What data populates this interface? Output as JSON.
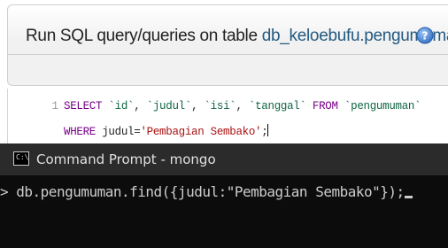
{
  "sql_panel": {
    "title_prefix": "Run SQL query/queries on table ",
    "db_link": "db_keloebufu.pengumuman:",
    "help_icon": "help-icon",
    "line_numbers": [
      "1"
    ],
    "line1": {
      "kw1": "SELECT",
      "id1": "`id`",
      "sep1": ", ",
      "id2": "`judul`",
      "sep2": ", ",
      "id3": "`isi`",
      "sep3": ", ",
      "id4": "`tanggal`",
      "kw2": "FROM",
      "id5": "`pengumuman`"
    },
    "line2": {
      "kw1": "WHERE",
      "field": " judul=",
      "value": "'Pembagian Sembako'",
      "end": ";"
    }
  },
  "cmd": {
    "window_title": "Command Prompt - mongo",
    "icon": "cmd-icon",
    "icon_text": "C:\\",
    "prompt": ">",
    "command": " db.pengumuman.find({judul:\"Pembagian Sembako\"});"
  }
}
